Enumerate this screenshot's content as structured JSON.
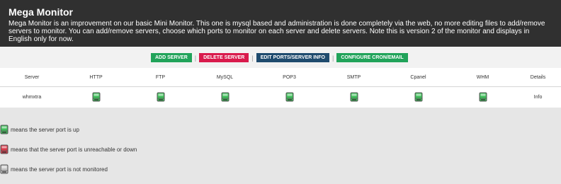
{
  "header": {
    "title": "Mega Monitor",
    "description": "Mega Monitor is an improvement on our basic Mini Monitor. This one is mysql based and administration is done completely via the web, no more editing files to add/remove servers to monitor. You can add/remove servers, choose which ports to monitor on each server and delete servers. Note this is version 2 of the monitor and displays in English only for now."
  },
  "toolbar": {
    "buttons": [
      {
        "label": "ADD SERVER",
        "color": "#21a35a"
      },
      {
        "label": "DELETE SERVER",
        "color": "#d91a4c"
      },
      {
        "label": "EDIT PORTS/SERVER INFO",
        "color": "#1f4b6e"
      },
      {
        "label": "CONFIGURE CRON/EMAIL",
        "color": "#21a35a"
      }
    ],
    "separator": "|"
  },
  "table": {
    "columns": [
      "Server",
      "HTTP",
      "FTP",
      "MySQL",
      "POP3",
      "SMTP",
      "Cpanel",
      "WHM",
      "Details"
    ],
    "rows": [
      {
        "server": "whmxtra",
        "status": [
          "up",
          "up",
          "up",
          "up",
          "up",
          "up",
          "up"
        ],
        "details": "Info"
      }
    ]
  },
  "legend": [
    {
      "icon": "server-up-icon",
      "text": "means the server port is up"
    },
    {
      "icon": "server-down-icon",
      "text": "means that the server port is unreachable or down"
    },
    {
      "icon": "server-unmonitored-icon",
      "text": "means the server port is not monitored"
    }
  ],
  "colors": {
    "header_bg": "#303030",
    "up": "#3fbf5a",
    "down": "#d93a4a",
    "unmonitored": "#c8c8c8"
  }
}
